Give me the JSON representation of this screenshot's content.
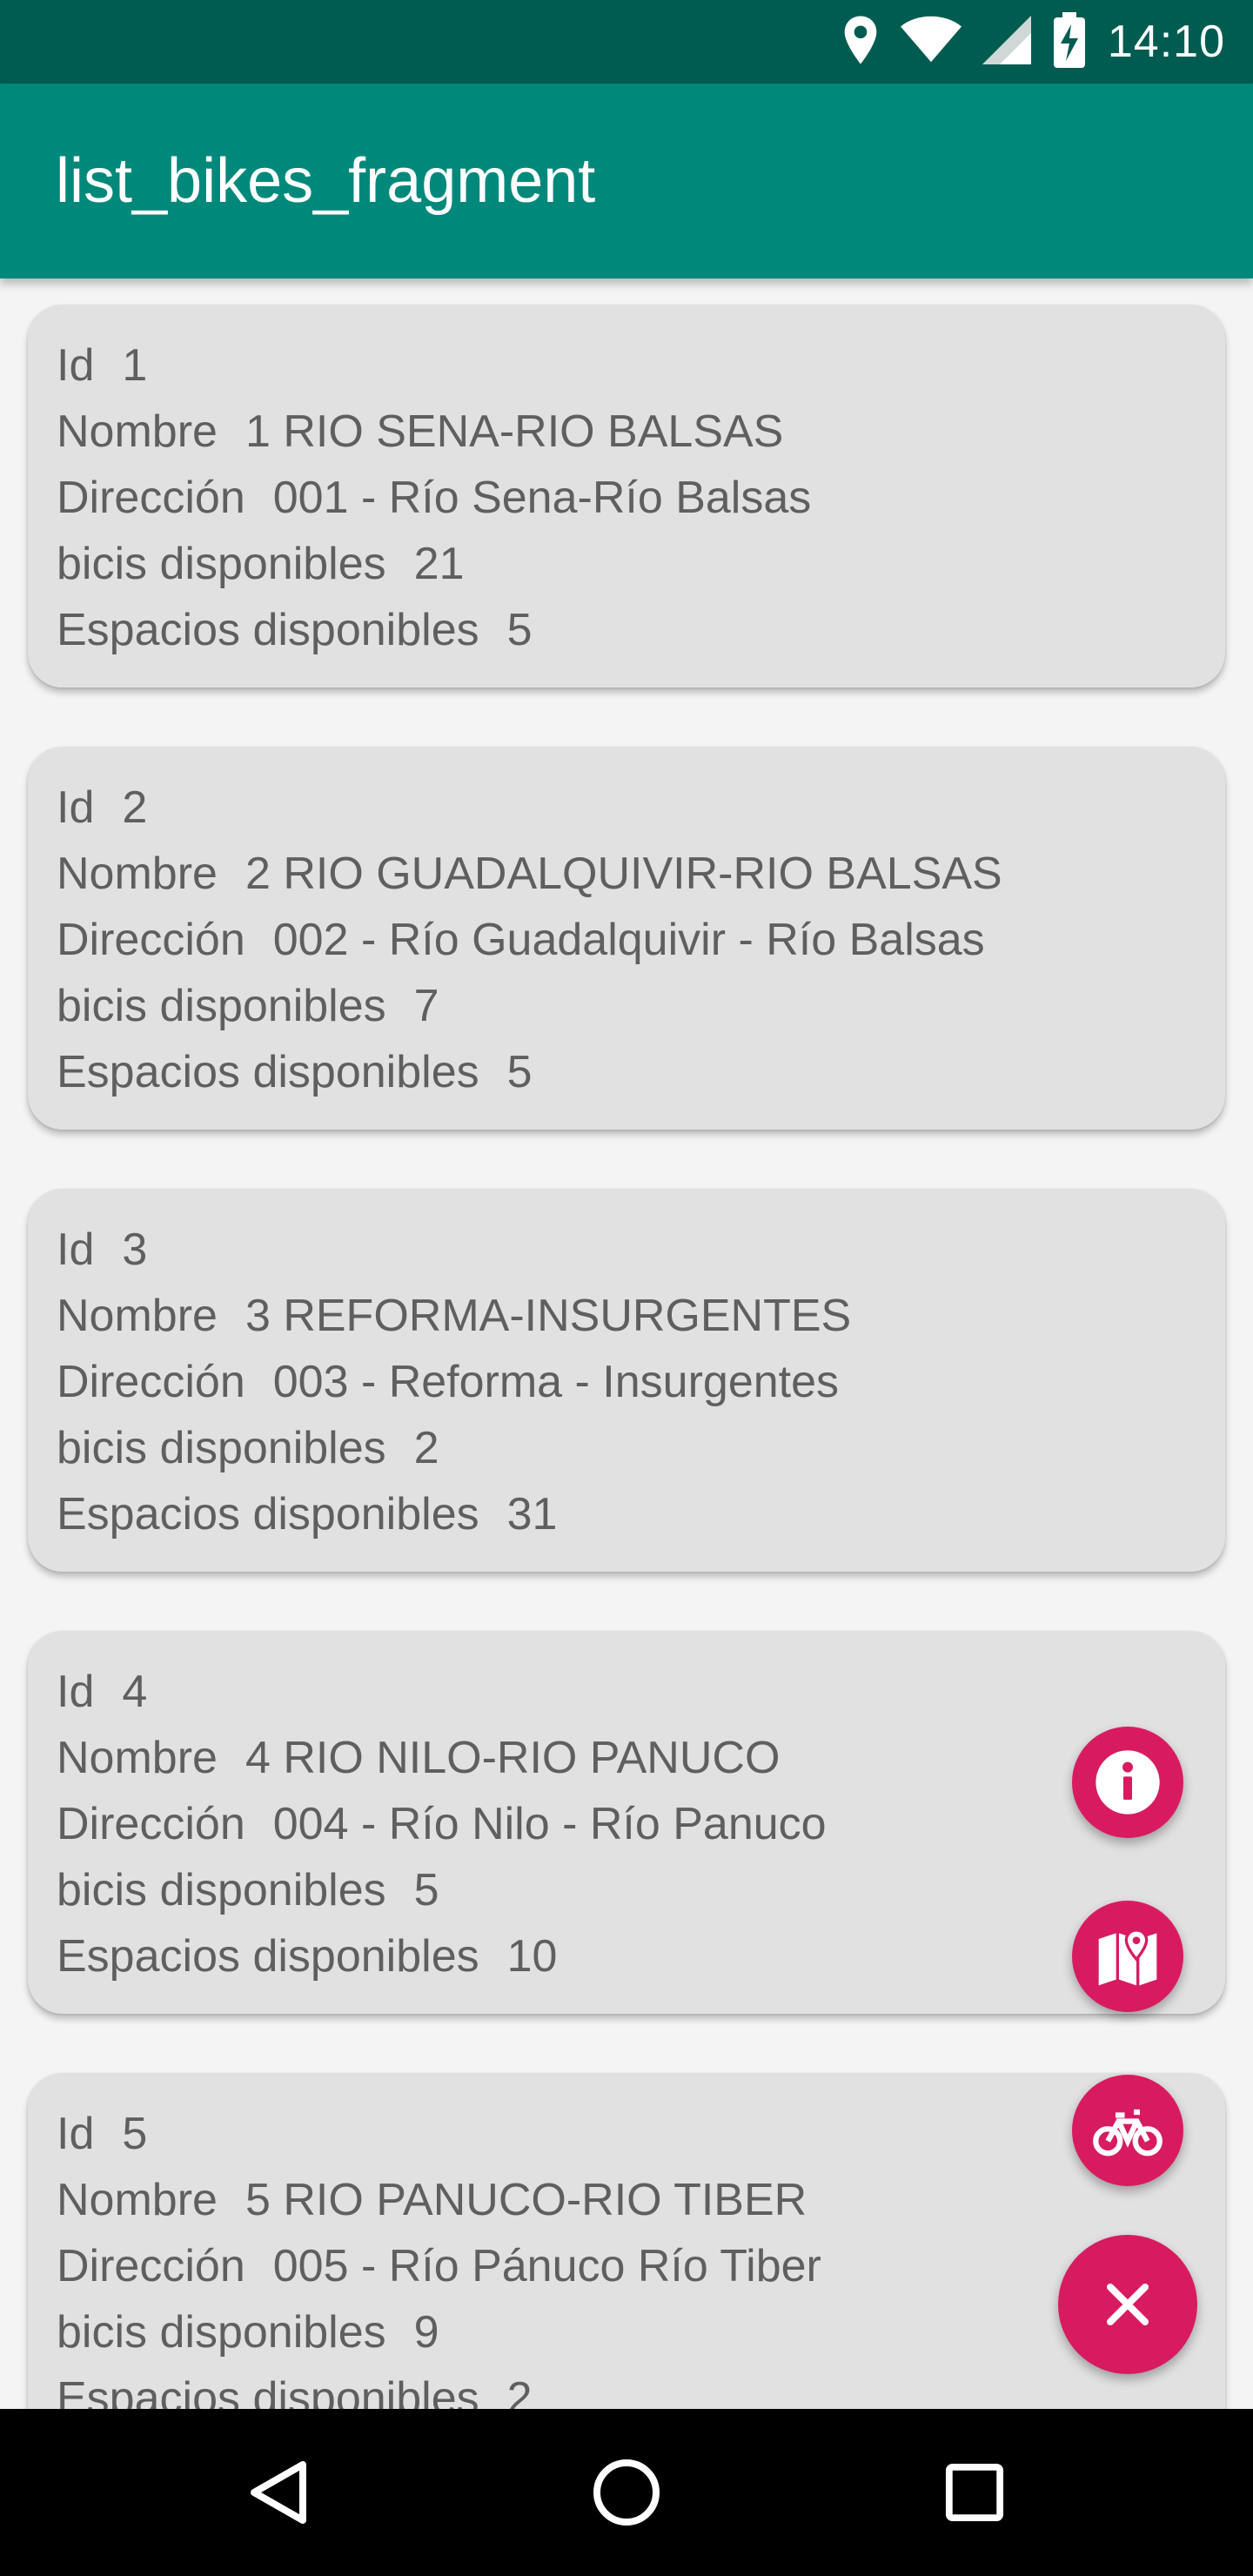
{
  "status_bar": {
    "time": "14:10",
    "icons": [
      "location-icon",
      "wifi-icon",
      "signal-icon",
      "battery-charging-icon"
    ]
  },
  "app_bar": {
    "title": "list_bikes_fragment"
  },
  "labels": {
    "id": "Id",
    "nombre": "Nombre",
    "direccion": "Dirección",
    "bicis": "bicis disponibles",
    "espacios": "Espacios disponibles"
  },
  "stations": [
    {
      "id": "1",
      "nombre": "1 RIO SENA-RIO BALSAS",
      "direccion": "001 - Río Sena-Río Balsas",
      "bicis": "21",
      "espacios": "5"
    },
    {
      "id": "2",
      "nombre": "2 RIO GUADALQUIVIR-RIO BALSAS",
      "direccion": "002 - Río Guadalquivir - Río Balsas",
      "bicis": "7",
      "espacios": "5"
    },
    {
      "id": "3",
      "nombre": "3 REFORMA-INSURGENTES",
      "direccion": "003 - Reforma - Insurgentes",
      "bicis": "2",
      "espacios": "31"
    },
    {
      "id": "4",
      "nombre": "4 RIO NILO-RIO PANUCO",
      "direccion": "004 - Río Nilo - Río Panuco",
      "bicis": "5",
      "espacios": "10"
    },
    {
      "id": "5",
      "nombre": "5 RIO PANUCO-RIO TIBER",
      "direccion": "005 - Río Pánuco Río Tiber",
      "bicis": "9",
      "espacios": "2"
    }
  ],
  "fabs": [
    {
      "name": "info-fab",
      "icon": "info-icon"
    },
    {
      "name": "map-fab",
      "icon": "map-icon"
    },
    {
      "name": "bike-fab",
      "icon": "bike-icon"
    },
    {
      "name": "close-fab",
      "icon": "close-icon"
    }
  ],
  "nav_bar": {
    "buttons": [
      "back-icon",
      "home-icon",
      "recents-icon"
    ]
  },
  "colors": {
    "status_bar": "#005c51",
    "app_bar": "#00897b",
    "card": "#e2e1e1",
    "fab": "#d81b60",
    "text": "#5f5f5f",
    "nav_bar": "#000000"
  }
}
